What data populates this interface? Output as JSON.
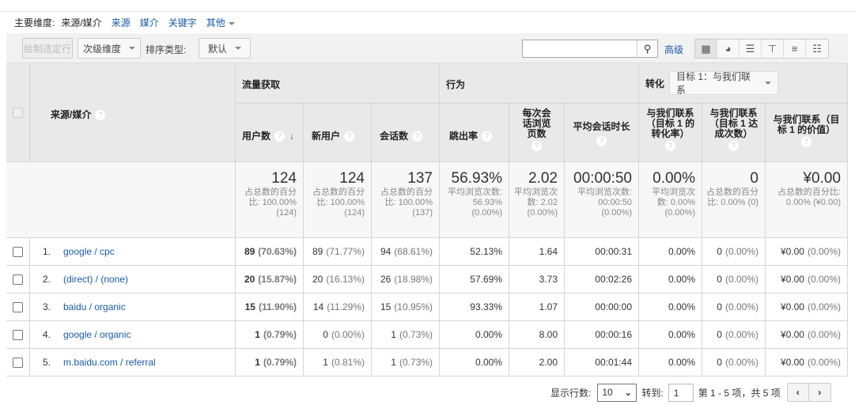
{
  "dimensions": {
    "label": "主要维度:",
    "current": "来源/媒介",
    "links": [
      "来源",
      "媒介",
      "关键字"
    ],
    "other": "其他"
  },
  "toolbar": {
    "plot_rows": "绘制选定行",
    "secondary_dim": "次级维度",
    "sort_label": "排序类型:",
    "sort_value": "默认",
    "search_value": "",
    "advanced": "高级"
  },
  "headers": {
    "dimension": "来源/媒介",
    "acquisition": "流量获取",
    "behavior": "行为",
    "conversion": "转化",
    "goal_select": "目标 1：与我们联系",
    "columns": [
      "用户数",
      "新用户",
      "会话数",
      "跳出率",
      "每次会话浏览页数",
      "平均会话时长",
      "与我们联系（目标 1 的转化率）",
      "与我们联系（目标 1 达成次数）",
      "与我们联系（目标 1 的价值）"
    ]
  },
  "totals": [
    {
      "value": "124",
      "sub": "占总数的百分比: 100.00% (124)"
    },
    {
      "value": "124",
      "sub": "占总数的百分比: 100.00% (124)"
    },
    {
      "value": "137",
      "sub": "占总数的百分比: 100.00% (137)"
    },
    {
      "value": "56.93%",
      "sub": "平均浏览次数: 56.93% (0.00%)"
    },
    {
      "value": "2.02",
      "sub": "平均浏览次数: 2.02 (0.00%)"
    },
    {
      "value": "00:00:50",
      "sub": "平均浏览次数: 00:00:50 (0.00%)"
    },
    {
      "value": "0.00%",
      "sub": "平均浏览次数: 0.00% (0.00%)"
    },
    {
      "value": "0",
      "sub": "占总数的百分比: 0.00% (0)"
    },
    {
      "value": "¥0.00",
      "sub": "占总数的百分比: 0.00% (¥0.00)"
    }
  ],
  "rows": [
    {
      "idx": "1.",
      "dim": "google / cpc",
      "users": "89",
      "users_pct": "(70.63%)",
      "new": "89",
      "new_pct": "(71.77%)",
      "sess": "94",
      "sess_pct": "(68.61%)",
      "bounce": "52.13%",
      "pages": "1.64",
      "dur": "00:00:31",
      "cr": "0.00%",
      "comp": "0",
      "comp_pct": "(0.00%)",
      "val": "¥0.00",
      "val_pct": "(0.00%)"
    },
    {
      "idx": "2.",
      "dim": "(direct) / (none)",
      "users": "20",
      "users_pct": "(15.87%)",
      "new": "20",
      "new_pct": "(16.13%)",
      "sess": "26",
      "sess_pct": "(18.98%)",
      "bounce": "57.69%",
      "pages": "3.73",
      "dur": "00:02:26",
      "cr": "0.00%",
      "comp": "0",
      "comp_pct": "(0.00%)",
      "val": "¥0.00",
      "val_pct": "(0.00%)"
    },
    {
      "idx": "3.",
      "dim": "baidu / organic",
      "users": "15",
      "users_pct": "(11.90%)",
      "new": "14",
      "new_pct": "(11.29%)",
      "sess": "15",
      "sess_pct": "(10.95%)",
      "bounce": "93.33%",
      "pages": "1.07",
      "dur": "00:00:00",
      "cr": "0.00%",
      "comp": "0",
      "comp_pct": "(0.00%)",
      "val": "¥0.00",
      "val_pct": "(0.00%)"
    },
    {
      "idx": "4.",
      "dim": "google / organic",
      "users": "1",
      "users_pct": "(0.79%)",
      "new": "0",
      "new_pct": "(0.00%)",
      "sess": "1",
      "sess_pct": "(0.73%)",
      "bounce": "0.00%",
      "pages": "8.00",
      "dur": "00:00:16",
      "cr": "0.00%",
      "comp": "0",
      "comp_pct": "(0.00%)",
      "val": "¥0.00",
      "val_pct": "(0.00%)"
    },
    {
      "idx": "5.",
      "dim": "m.baidu.com / referral",
      "users": "1",
      "users_pct": "(0.79%)",
      "new": "1",
      "new_pct": "(0.81%)",
      "sess": "1",
      "sess_pct": "(0.73%)",
      "bounce": "0.00%",
      "pages": "2.00",
      "dur": "00:01:44",
      "cr": "0.00%",
      "comp": "0",
      "comp_pct": "(0.00%)",
      "val": "¥0.00",
      "val_pct": "(0.00%)"
    }
  ],
  "pager": {
    "rows_label": "显示行数:",
    "rows_value": "10",
    "goto_label": "转到:",
    "goto_value": "1",
    "range": "第 1 - 5 项，共 5 项"
  }
}
